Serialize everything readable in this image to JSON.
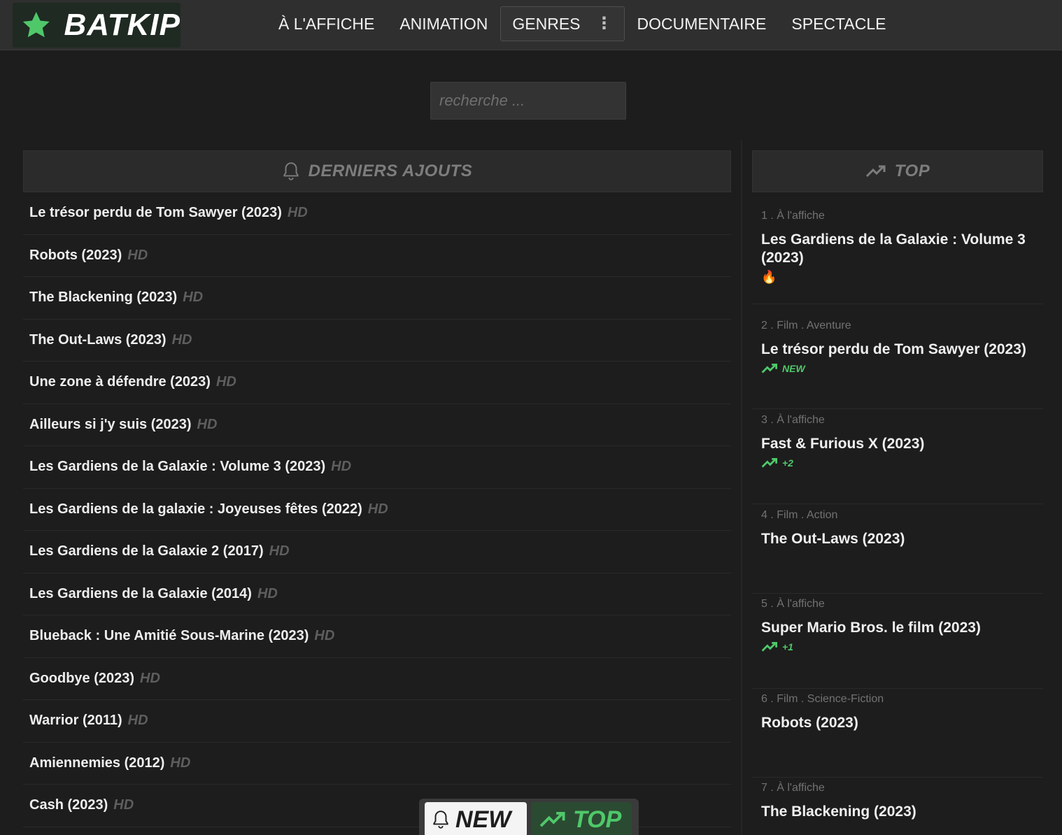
{
  "brand": {
    "name": "BATKIP",
    "accent": "#4fc86a"
  },
  "nav": {
    "items": [
      "À L'AFFICHE",
      "ANIMATION",
      "GENRES",
      "DOCUMENTAIRE",
      "SPECTACLE"
    ],
    "genres_menu_icon": "kebab-icon"
  },
  "search": {
    "placeholder": "recherche ..."
  },
  "latest": {
    "title": "DERNIERS AJOUTS",
    "icon": "bell-icon",
    "items": [
      {
        "title": "Le trésor perdu de Tom Sawyer (2023)",
        "quality": "HD"
      },
      {
        "title": "Robots (2023)",
        "quality": "HD"
      },
      {
        "title": "The Blackening (2023)",
        "quality": "HD"
      },
      {
        "title": "The Out-Laws (2023)",
        "quality": "HD"
      },
      {
        "title": "Une zone à défendre (2023)",
        "quality": "HD"
      },
      {
        "title": "Ailleurs si j'y suis (2023)",
        "quality": "HD"
      },
      {
        "title": "Les Gardiens de la Galaxie : Volume 3 (2023)",
        "quality": "HD"
      },
      {
        "title": "Les Gardiens de la galaxie : Joyeuses fêtes (2022)",
        "quality": "HD"
      },
      {
        "title": "Les Gardiens de la Galaxie 2 (2017)",
        "quality": "HD"
      },
      {
        "title": "Les Gardiens de la Galaxie (2014)",
        "quality": "HD"
      },
      {
        "title": "Blueback : Une Amitié Sous-Marine (2023)",
        "quality": "HD"
      },
      {
        "title": "Goodbye (2023)",
        "quality": "HD"
      },
      {
        "title": "Warrior (2011)",
        "quality": "HD"
      },
      {
        "title": "Amiennemies (2012)",
        "quality": "HD"
      },
      {
        "title": "Cash (2023)",
        "quality": "HD"
      }
    ]
  },
  "top": {
    "title": "TOP",
    "icon": "trending-up-icon",
    "items": [
      {
        "meta": "1 . À l'affiche",
        "title": "Les Gardiens de la Galaxie : Volume 3 (2023)",
        "trend": "",
        "badge": "fire-icon"
      },
      {
        "meta": "2 . Film . Aventure",
        "title": "Le trésor perdu de Tom Sawyer (2023)",
        "trend": "NEW",
        "badge": ""
      },
      {
        "meta": "3 . À l'affiche",
        "title": "Fast & Furious X (2023)",
        "trend": "+2",
        "badge": ""
      },
      {
        "meta": "4 . Film . Action",
        "title": "The Out-Laws (2023)",
        "trend": "",
        "badge": ""
      },
      {
        "meta": "5 . À l'affiche",
        "title": "Super Mario Bros. le film (2023)",
        "trend": "+1",
        "badge": ""
      },
      {
        "meta": "6 . Film . Science-Fiction",
        "title": "Robots (2023)",
        "trend": "",
        "badge": ""
      },
      {
        "meta": "7 . À l'affiche",
        "title": "The Blackening (2023)",
        "trend": "",
        "badge": ""
      }
    ]
  },
  "floating": {
    "new_label": "NEW",
    "top_label": "TOP"
  }
}
